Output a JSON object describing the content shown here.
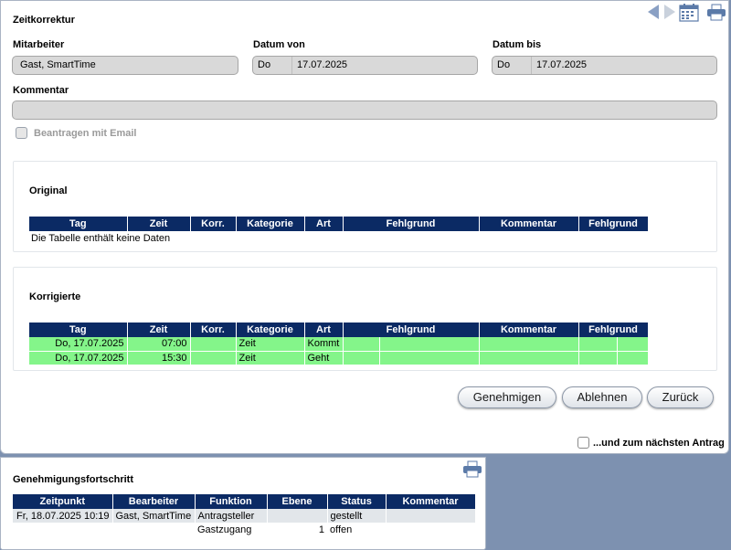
{
  "header": {
    "title": "Zeitkorrektur",
    "icons": [
      "prev-arrow-icon",
      "next-arrow-icon",
      "calendar-icon",
      "print-icon"
    ]
  },
  "form": {
    "mitarbeiter_label": "Mitarbeiter",
    "mitarbeiter_value": "Gast, SmartTime",
    "datum_von_label": "Datum von",
    "datum_von_dow": "Do",
    "datum_von_value": "17.07.2025",
    "datum_bis_label": "Datum bis",
    "datum_bis_dow": "Do",
    "datum_bis_value": "17.07.2025",
    "kommentar_label": "Kommentar",
    "kommentar_value": "",
    "beantragen_label": "Beantragen mit Email"
  },
  "table_headers": [
    "Tag",
    "Zeit",
    "Korr.",
    "Kategorie",
    "Art",
    "Fehlgrund",
    "Kommentar",
    "Fehlgrund"
  ],
  "original": {
    "title": "Original",
    "empty_text": "Die Tabelle enthält keine Daten"
  },
  "korrigierte": {
    "title": "Korrigierte",
    "rows": [
      {
        "tag": "Do, 17.07.2025",
        "zeit": "07:00",
        "korr": "",
        "kategorie": "Zeit",
        "art": "Kommt"
      },
      {
        "tag": "Do, 17.07.2025",
        "zeit": "15:30",
        "korr": "",
        "kategorie": "Zeit",
        "art": "Geht"
      }
    ]
  },
  "buttons": {
    "genehmigen": "Genehmigen",
    "ablehnen": "Ablehnen",
    "zurueck": "Zurück"
  },
  "next_request_label": "...und zum nächsten Antrag",
  "progress": {
    "title": "Genehmigungsfortschritt",
    "headers": [
      "Zeitpunkt",
      "Bearbeiter",
      "Funktion",
      "Ebene",
      "Status",
      "Kommentar"
    ],
    "rows": [
      {
        "zeitpunkt": "Fr, 18.07.2025 10:19",
        "bearbeiter": "Gast, SmartTime",
        "funktion": "Antragsteller",
        "ebene": "",
        "status": "gestellt",
        "kommentar": ""
      },
      {
        "zeitpunkt": "",
        "bearbeiter": "",
        "funktion": "Gastzugang",
        "ebene": "1",
        "status": "offen",
        "kommentar": ""
      }
    ]
  },
  "colors": {
    "header_navy": "#0b2a64",
    "row_green": "#84f58a",
    "background_blue": "#7d91b0"
  }
}
